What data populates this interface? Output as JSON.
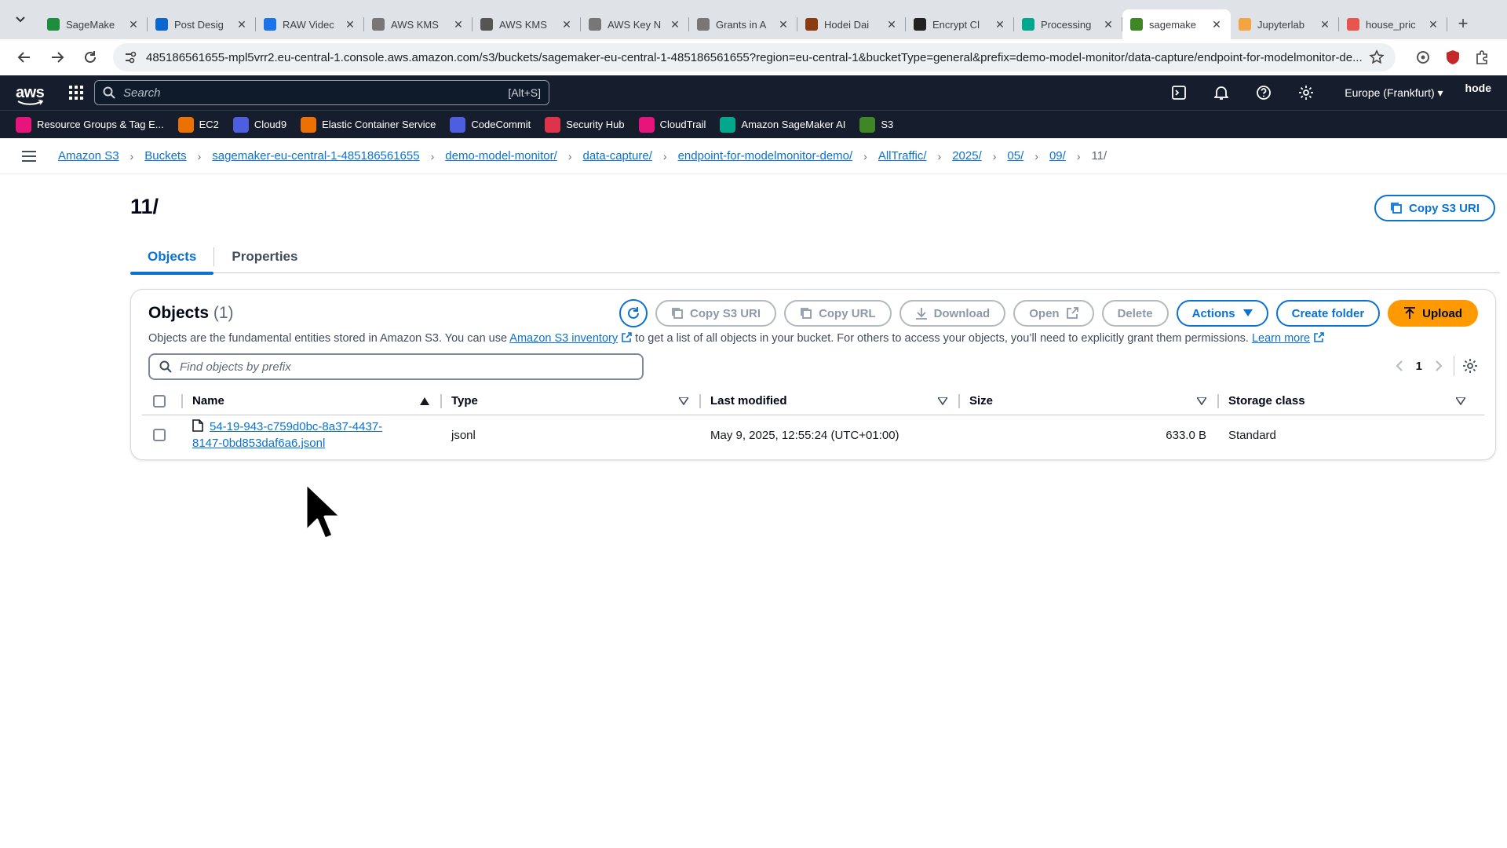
{
  "browser": {
    "tabs": [
      {
        "title": "SageMake",
        "fav_color": "#1e8e3e",
        "icon": "sheets-icon"
      },
      {
        "title": "Post Desig",
        "fav_color": "#0b66d0",
        "icon": "cloud-icon"
      },
      {
        "title": "RAW Videc",
        "fav_color": "#1a73e8",
        "icon": "drive-icon"
      },
      {
        "title": "AWS KMS",
        "fav_color": "#777777",
        "icon": "github-icon"
      },
      {
        "title": "AWS KMS",
        "fav_color": "#555555",
        "icon": "openai-icon"
      },
      {
        "title": "AWS Key N",
        "fav_color": "#777777",
        "icon": "github-icon"
      },
      {
        "title": "Grants in A",
        "fav_color": "#777777",
        "icon": "github-icon"
      },
      {
        "title": "Hodei Dai",
        "fav_color": "#8a3b12",
        "icon": "notion-icon"
      },
      {
        "title": "Encrypt Cl",
        "fav_color": "#222222",
        "icon": "openai-icon"
      },
      {
        "title": "Processing",
        "fav_color": "#01a88d",
        "icon": "sagemaker-icon"
      },
      {
        "title": "sagemake",
        "fav_color": "#3f8624",
        "icon": "s3-icon",
        "active": true
      },
      {
        "title": "Jupyterlab",
        "fav_color": "#f2a541",
        "icon": "jupyter-icon"
      },
      {
        "title": "house_pric",
        "fav_color": "#e8554e",
        "icon": "loading-icon"
      }
    ],
    "url": "485186561655-mpl5vrr2.eu-central-1.console.aws.amazon.com/s3/buckets/sagemaker-eu-central-1-485186561655?region=eu-central-1&bucketType=general&prefix=demo-model-monitor/data-capture/endpoint-for-modelmonitor-de..."
  },
  "aws": {
    "logo": "aws",
    "search_placeholder": "Search",
    "search_shortcut": "[Alt+S]",
    "region": "Europe (Frankfurt)",
    "user": "hode",
    "favorites": [
      {
        "label": "Resource Groups & Tag E...",
        "color": "#e7157b"
      },
      {
        "label": "EC2",
        "color": "#ed7100"
      },
      {
        "label": "Cloud9",
        "color": "#4d5fe0"
      },
      {
        "label": "Elastic Container Service",
        "color": "#ed7100"
      },
      {
        "label": "CodeCommit",
        "color": "#4d5fe0"
      },
      {
        "label": "Security Hub",
        "color": "#dd344c"
      },
      {
        "label": "CloudTrail",
        "color": "#e7157b"
      },
      {
        "label": "Amazon SageMaker AI",
        "color": "#01a88d"
      },
      {
        "label": "S3",
        "color": "#3f8624"
      }
    ]
  },
  "breadcrumb": [
    "Amazon S3",
    "Buckets",
    "sagemaker-eu-central-1-485186561655",
    "demo-model-monitor/",
    "data-capture/",
    "endpoint-for-modelmonitor-demo/",
    "AllTraffic/",
    "2025/",
    "05/",
    "09/",
    "11/"
  ],
  "page": {
    "title": "11/",
    "copy_uri_label": "Copy S3 URI",
    "tabs": [
      "Objects",
      "Properties"
    ]
  },
  "objects_panel": {
    "title": "Objects",
    "count": "(1)",
    "buttons": {
      "copy_s3_uri": "Copy S3 URI",
      "copy_url": "Copy URL",
      "download": "Download",
      "open": "Open",
      "delete": "Delete",
      "actions": "Actions",
      "create_folder": "Create folder",
      "upload": "Upload"
    },
    "desc_1": "Objects are the fundamental entities stored in Amazon S3. You can use ",
    "desc_link_1": "Amazon S3 inventory",
    "desc_2": " to get a list of all objects in your bucket. For others to access your objects, you’ll need to explicitly grant them permissions. ",
    "desc_link_2": "Learn more",
    "filter_placeholder": "Find objects by prefix",
    "page_number": "1",
    "columns": [
      "Name",
      "Type",
      "Last modified",
      "Size",
      "Storage class"
    ],
    "rows": [
      {
        "name_line1": "54-19-943-c759d0bc-8a37-4437-",
        "name_line2": "8147-0bd853daf6a6.jsonl",
        "type": "jsonl",
        "last_modified": "May 9, 2025, 12:55:24 (UTC+01:00)",
        "size": "633.0 B",
        "storage_class": "Standard"
      }
    ]
  },
  "colors": {
    "link": "#0972d3",
    "upload": "#ff9900",
    "aws_header": "#161e2d"
  }
}
